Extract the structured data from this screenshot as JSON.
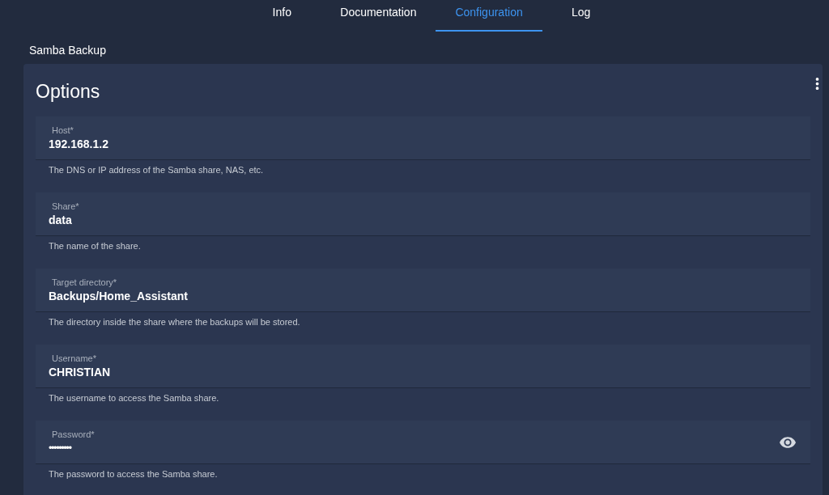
{
  "tabs": [
    {
      "label": "Info",
      "selected": false
    },
    {
      "label": "Documentation",
      "selected": false
    },
    {
      "label": "Configuration",
      "selected": true
    },
    {
      "label": "Log",
      "selected": false
    }
  ],
  "addon_title": "Samba Backup",
  "card": {
    "title": "Options",
    "fields": [
      {
        "kind": "text",
        "label": "Host*",
        "value": "192.168.1.2",
        "helper": "The DNS or IP address of the Samba share, NAS, etc."
      },
      {
        "kind": "text",
        "label": "Share*",
        "value": "data",
        "helper": "The name of the share."
      },
      {
        "kind": "text",
        "label": "Target directory*",
        "value": "Backups/Home_Assistant",
        "helper": "The directory inside the share where the backups will be stored."
      },
      {
        "kind": "text",
        "label": "Username*",
        "value": "CHRISTIAN",
        "helper": "The username to access the Samba share."
      },
      {
        "kind": "password",
        "label": "Password*",
        "value": "•••••••••",
        "helper": "The password to access the Samba share."
      }
    ]
  }
}
